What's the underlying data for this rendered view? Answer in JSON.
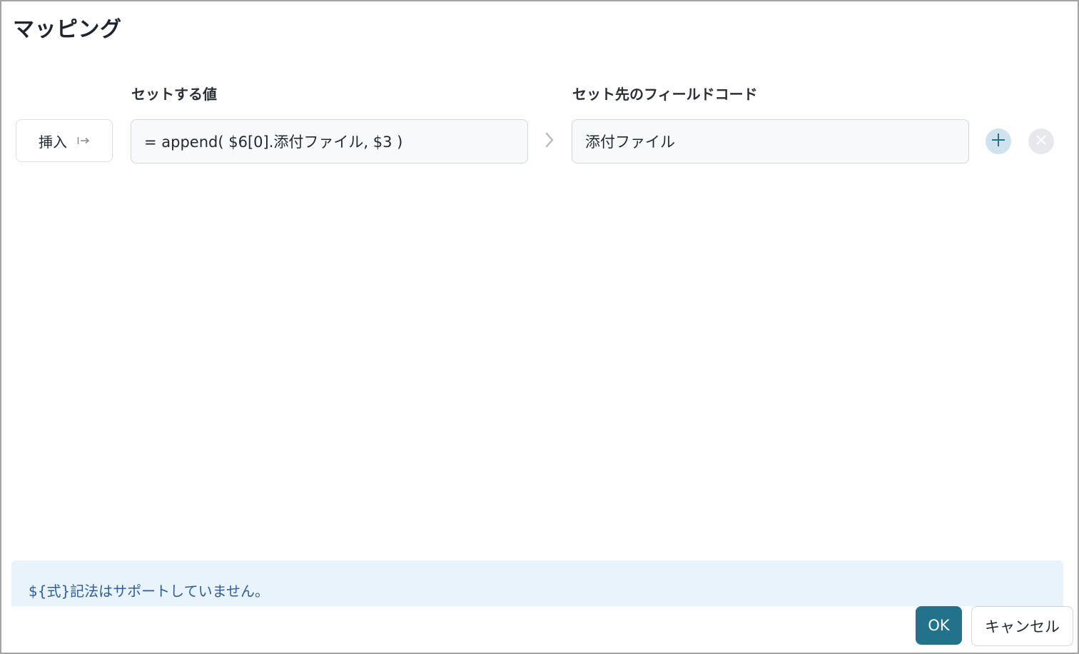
{
  "dialog": {
    "title": "マッピング"
  },
  "columns": {
    "value_header": "セットする値",
    "field_header": "セット先のフィールドコード"
  },
  "mapping_row": {
    "insert_label": "挿入",
    "insert_icon": "insert-arrow-icon",
    "value_expression": "= append( $6[0].添付ファイル, $3 )",
    "separator_icon": "chevron-right-icon",
    "field_code": "添付ファイル",
    "add_icon": "plus-icon",
    "remove_icon": "close-icon"
  },
  "info_banner": {
    "message": "${式}記法はサポートしていません。"
  },
  "footer": {
    "ok_label": "OK",
    "cancel_label": "キャンセル"
  },
  "colors": {
    "primary": "#23728c",
    "info_background": "#e8f3fc",
    "info_text": "#2f5d9e",
    "add_button_bg": "#cfe3ee",
    "remove_button_bg": "#e6e8eb"
  }
}
